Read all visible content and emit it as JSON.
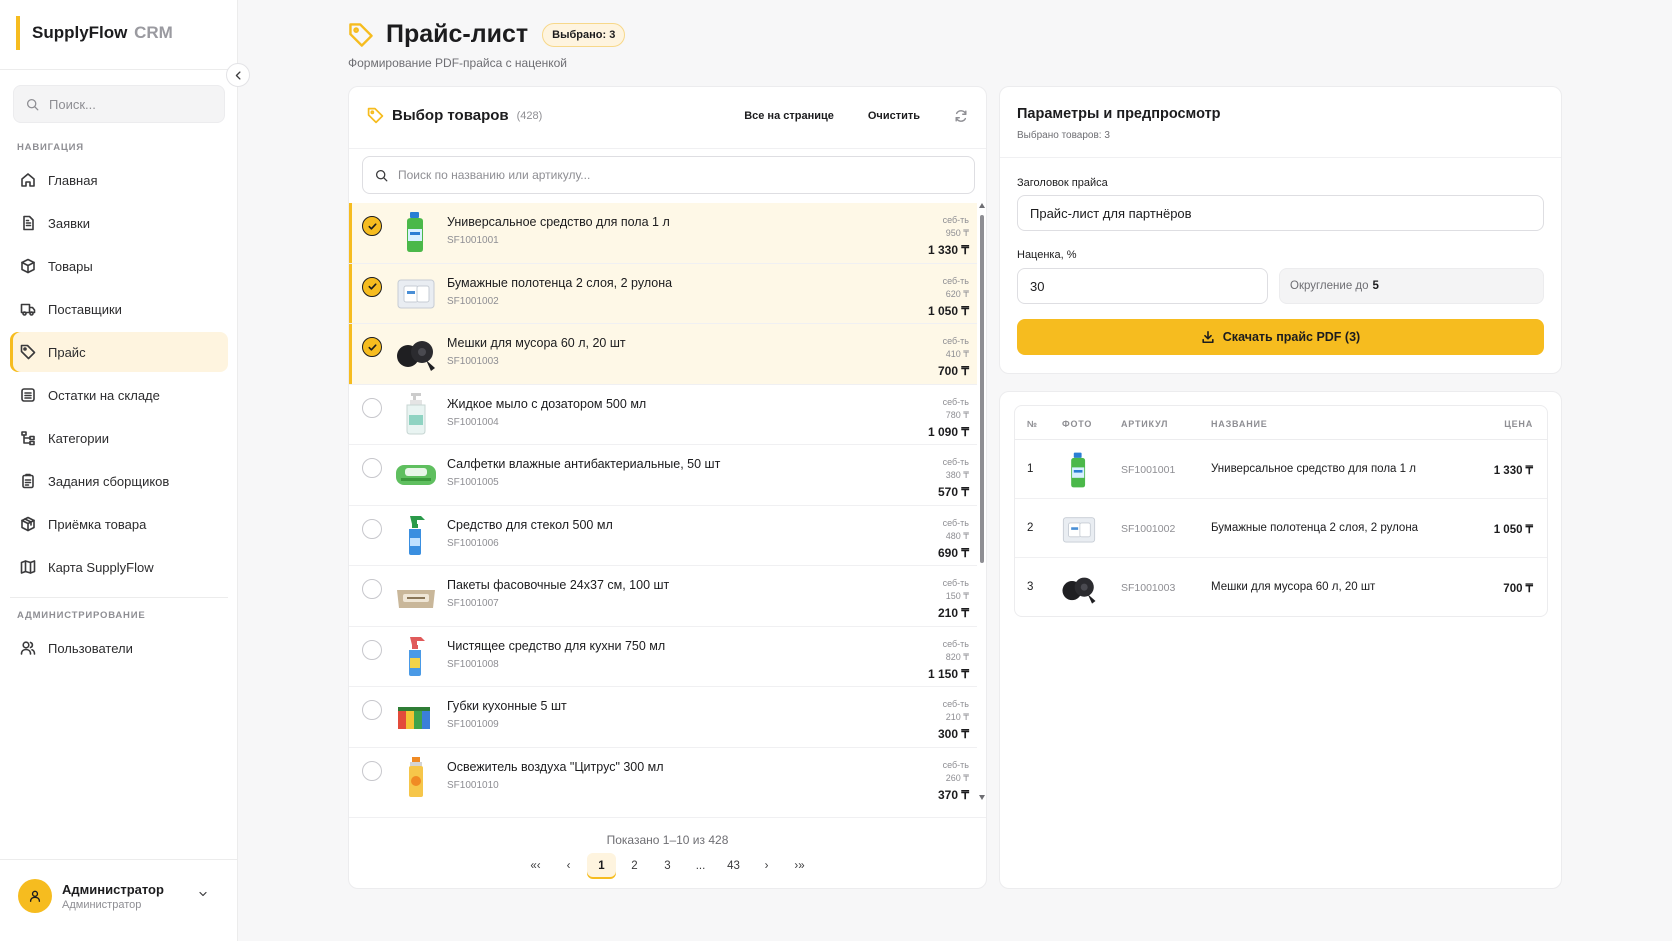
{
  "app": {
    "brand": "SupplyFlow",
    "brand_suffix": "CRM"
  },
  "sidebar": {
    "search_placeholder": "Поиск...",
    "nav_section": "НАВИГАЦИЯ",
    "admin_section": "АДМИНИСТРИРОВАНИЕ",
    "items": [
      {
        "label": "Главная",
        "icon": "home-icon"
      },
      {
        "label": "Заявки",
        "icon": "document-icon"
      },
      {
        "label": "Товары",
        "icon": "box-icon"
      },
      {
        "label": "Поставщики",
        "icon": "truck-icon"
      },
      {
        "label": "Прайс",
        "icon": "tag-icon",
        "active": true
      },
      {
        "label": "Остатки на складе",
        "icon": "warehouse-icon"
      },
      {
        "label": "Категории",
        "icon": "tree-icon"
      },
      {
        "label": "Задания сборщиков",
        "icon": "clipboard-icon"
      },
      {
        "label": "Приёмка товара",
        "icon": "package-icon"
      },
      {
        "label": "Карта SupplyFlow",
        "icon": "map-icon"
      }
    ],
    "admin_items": [
      {
        "label": "Пользователи",
        "icon": "users-icon"
      }
    ],
    "user": {
      "name": "Администратор",
      "role": "Администратор"
    }
  },
  "header": {
    "title": "Прайс-лист",
    "badge": "Выбрано: 3",
    "subtitle": "Формирование PDF-прайса с наценкой"
  },
  "products_panel": {
    "title": "Выбор товаров",
    "count": "(428)",
    "select_all": "Все на странице",
    "clear": "Очистить",
    "search_placeholder": "Поиск по названию или артикулу...",
    "cost_label": "себ-ть",
    "items": [
      {
        "name": "Универсальное средство для пола 1 л",
        "sku": "SF1001001",
        "cost": "950 ₸",
        "price": "1 330 ₸",
        "selected": true,
        "img": "bottle-green"
      },
      {
        "name": "Бумажные полотенца 2 слоя, 2 рулона",
        "sku": "SF1001002",
        "cost": "620 ₸",
        "price": "1 050 ₸",
        "selected": true,
        "img": "towels"
      },
      {
        "name": "Мешки для мусора 60 л, 20 шт",
        "sku": "SF1001003",
        "cost": "410 ₸",
        "price": "700 ₸",
        "selected": true,
        "img": "bags"
      },
      {
        "name": "Жидкое мыло с дозатором 500 мл",
        "sku": "SF1001004",
        "cost": "780 ₸",
        "price": "1 090 ₸",
        "selected": false,
        "img": "soap"
      },
      {
        "name": "Салфетки влажные антибактериальные, 50 шт",
        "sku": "SF1001005",
        "cost": "380 ₸",
        "price": "570 ₸",
        "selected": false,
        "img": "wipes"
      },
      {
        "name": "Средство для стекол 500 мл",
        "sku": "SF1001006",
        "cost": "480 ₸",
        "price": "690 ₸",
        "selected": false,
        "img": "spray-blue"
      },
      {
        "name": "Пакеты фасовочные 24x37 см, 100 шт",
        "sku": "SF1001007",
        "cost": "150 ₸",
        "price": "210 ₸",
        "selected": false,
        "img": "pack"
      },
      {
        "name": "Чистящее средство для кухни 750 мл",
        "sku": "SF1001008",
        "cost": "820 ₸",
        "price": "1 150 ₸",
        "selected": false,
        "img": "spray-blue2"
      },
      {
        "name": "Губки кухонные 5 шт",
        "sku": "SF1001009",
        "cost": "210 ₸",
        "price": "300 ₸",
        "selected": false,
        "img": "sponges"
      },
      {
        "name": "Освежитель воздуха \"Цитрус\" 300 мл",
        "sku": "SF1001010",
        "cost": "260 ₸",
        "price": "370 ₸",
        "selected": false,
        "img": "aerosol"
      }
    ],
    "shown": "Показано 1–10 из 428",
    "pager": {
      "first": "«‹",
      "prev": "‹",
      "pages": [
        "1",
        "2",
        "3",
        "...",
        "43"
      ],
      "current": "1",
      "next": "›",
      "last": "›»"
    }
  },
  "params": {
    "title": "Параметры и предпросмотр",
    "subtitle": "Выбрано товаров: 3",
    "heading_label": "Заголовок прайса",
    "heading_value": "Прайс-лист для партнёров",
    "markup_label": "Наценка, %",
    "markup_value": "30",
    "rounding_label": "Округление до",
    "rounding_value": "5",
    "download_label": "Скачать прайс PDF (3)"
  },
  "preview": {
    "columns": [
      "№",
      "ФОТО",
      "АРТИКУЛ",
      "НАЗВАНИЕ",
      "ЦЕНА"
    ],
    "rows": [
      {
        "n": "1",
        "sku": "SF1001001",
        "name": "Универсальное средство для пола 1 л",
        "price": "1 330 ₸",
        "img": "bottle-green"
      },
      {
        "n": "2",
        "sku": "SF1001002",
        "name": "Бумажные полотенца 2 слоя, 2 рулона",
        "price": "1 050 ₸",
        "img": "towels"
      },
      {
        "n": "3",
        "sku": "SF1001003",
        "name": "Мешки для мусора 60 л, 20 шт",
        "price": "700 ₸",
        "img": "bags"
      }
    ]
  },
  "colors": {
    "accent": "#f6bc1f",
    "accent_light": "#fef4df",
    "text": "#1c1c1e",
    "muted": "#8e8e93"
  }
}
